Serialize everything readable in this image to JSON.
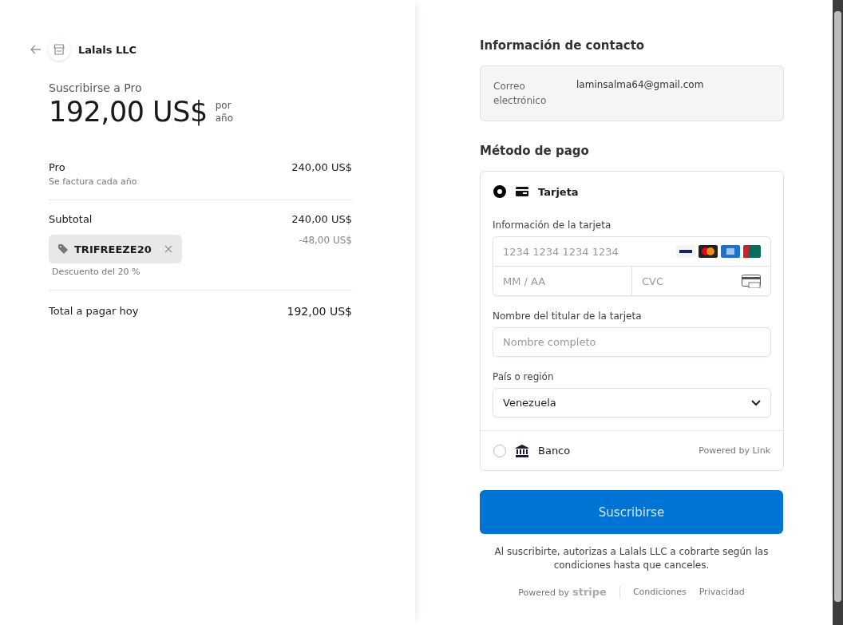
{
  "merchant": {
    "name": "Lalals LLC"
  },
  "summary": {
    "title": "Suscribirse a Pro",
    "price": "192,00 US$",
    "period_top": "por",
    "period_bottom": "año",
    "line_item": {
      "name": "Pro",
      "note": "Se factura cada año",
      "amount": "240,00 US$"
    },
    "subtotal": {
      "label": "Subtotal",
      "amount": "240,00 US$"
    },
    "promo": {
      "code": "TRIFREEZE20",
      "amount": "-48,00 US$",
      "note": "Descuento del 20 %"
    },
    "total": {
      "label": "Total a pagar hoy",
      "amount": "192,00 US$"
    }
  },
  "contact": {
    "heading": "Información de contacto",
    "email_label": "Correo electrónico",
    "email": "laminsalma64@gmail.com"
  },
  "payment": {
    "heading": "Método de pago",
    "methods": [
      {
        "kind": "card",
        "label": "Tarjeta",
        "selected": true,
        "card_info_label": "Información de la tarjeta",
        "number_placeholder": "1234 1234 1234 1234",
        "expiry_placeholder": "MM / AA",
        "cvc_placeholder": "CVC",
        "holder_label": "Nombre del titular de la tarjeta",
        "holder_placeholder": "Nombre completo",
        "country_label": "País o región",
        "country": "Venezuela"
      },
      {
        "kind": "bank",
        "label": "Banco",
        "selected": false,
        "note": "Powered by Link"
      }
    ]
  },
  "submit": {
    "label": "Suscribirse"
  },
  "legal": "Al suscribirte, autorizas a Lalals LLC a cobrarte según las condiciones hasta que canceles.",
  "footer": {
    "powered_by": "Powered by",
    "brand": "stripe",
    "links": [
      "Condiciones",
      "Privacidad"
    ]
  }
}
